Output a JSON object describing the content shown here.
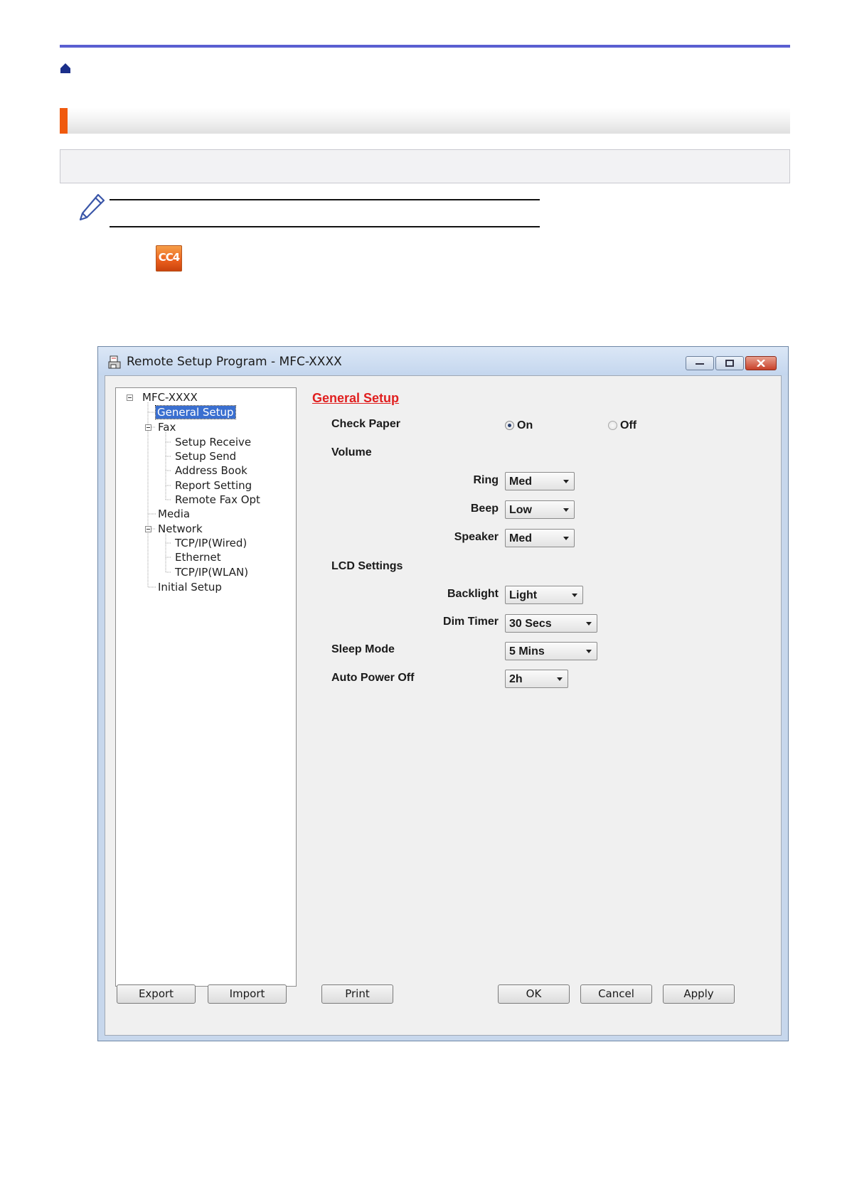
{
  "icon": "cc4-icon",
  "window": {
    "title": "Remote Setup Program - MFC-XXXX",
    "tree": {
      "root": "MFC-XXXX",
      "general_setup": "General Setup",
      "fax": "Fax",
      "setup_receive": "Setup Receive",
      "setup_send": "Setup Send",
      "address_book": "Address Book",
      "report_setting": "Report Setting",
      "remote_fax_opt": "Remote Fax Opt",
      "media": "Media",
      "network": "Network",
      "tcpip_wired": "TCP/IP(Wired)",
      "ethernet": "Ethernet",
      "tcpip_wlan": "TCP/IP(WLAN)",
      "initial_setup": "Initial Setup"
    },
    "panel": {
      "title": "General Setup",
      "check_paper": "Check Paper",
      "check_paper_on": "On",
      "check_paper_off": "Off",
      "check_paper_selected": "On",
      "volume": "Volume",
      "ring": "Ring",
      "ring_value": "Med",
      "beep": "Beep",
      "beep_value": "Low",
      "speaker": "Speaker",
      "speaker_value": "Med",
      "lcd_settings": "LCD Settings",
      "backlight": "Backlight",
      "backlight_value": "Light",
      "dim_timer": "Dim Timer",
      "dim_timer_value": "30 Secs",
      "sleep_mode": "Sleep Mode",
      "sleep_mode_value": "5 Mins",
      "auto_power_off": "Auto Power Off",
      "auto_power_off_value": "2h"
    },
    "buttons": {
      "export": "Export",
      "import": "Import",
      "print": "Print",
      "ok": "OK",
      "cancel": "Cancel",
      "apply": "Apply"
    }
  }
}
